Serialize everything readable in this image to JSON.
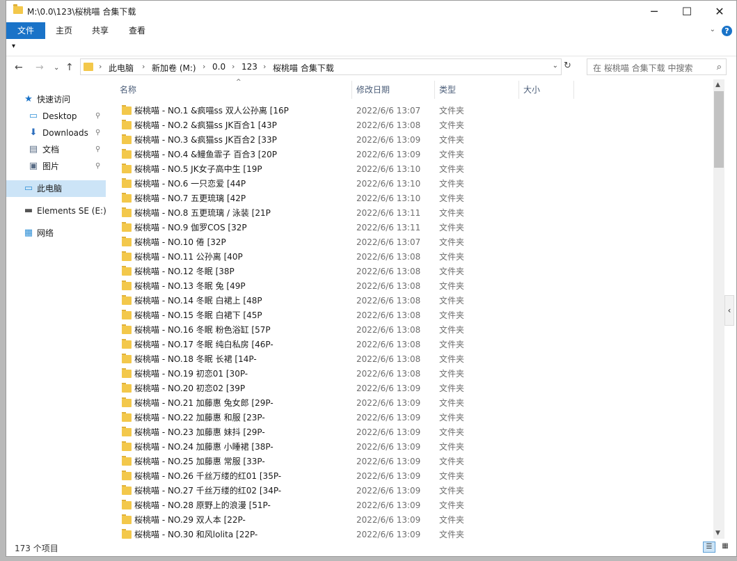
{
  "window": {
    "title": "M:\\0.0\\123\\桜桃喵 合集下载",
    "controls": [
      "─",
      "☐",
      "✕"
    ]
  },
  "ribbon": {
    "tabs": [
      "文件",
      "主页",
      "共享",
      "查看"
    ],
    "qat_label": "▾"
  },
  "address": {
    "crumbs": [
      "此电脑",
      "新加卷 (M:)",
      "0.0",
      "123",
      "桜桃喵 合集下载"
    ],
    "search_placeholder": "在 桜桃喵 合集下载 中搜索"
  },
  "navpane": {
    "items": [
      {
        "label": "快速访问",
        "icon": "star-icon",
        "pinned": false
      },
      {
        "label": "Desktop",
        "icon": "desktop-icon",
        "pinned": true
      },
      {
        "label": "Downloads",
        "icon": "download-icon",
        "pinned": true
      },
      {
        "label": "文档",
        "icon": "document-icon",
        "pinned": true
      },
      {
        "label": "图片",
        "icon": "picture-icon",
        "pinned": true
      },
      {
        "label": "此电脑",
        "icon": "computer-icon",
        "pinned": false,
        "selected": true
      },
      {
        "label": "Elements SE (E:)",
        "icon": "drive-icon",
        "pinned": false
      },
      {
        "label": "网络",
        "icon": "network-icon",
        "pinned": false
      }
    ]
  },
  "columns": [
    "名称",
    "修改日期",
    "类型",
    "大小"
  ],
  "files": [
    {
      "name": "桜桃喵 - NO.1 &疯喵ss 双人公孙离 [16P",
      "date": "2022/6/6 13:07",
      "type": "文件夹"
    },
    {
      "name": "桜桃喵 - NO.2 &疯猫ss JK百合1 [43P",
      "date": "2022/6/6 13:08",
      "type": "文件夹"
    },
    {
      "name": "桜桃喵 - NO.3 &疯猫ss JK百合2 [33P",
      "date": "2022/6/6 13:09",
      "type": "文件夹"
    },
    {
      "name": "桜桃喵 - NO.4 &鳗鱼霏子 百合3 [20P",
      "date": "2022/6/6 13:09",
      "type": "文件夹"
    },
    {
      "name": "桜桃喵 - NO.5 JK女子高中生 [19P",
      "date": "2022/6/6 13:10",
      "type": "文件夹"
    },
    {
      "name": "桜桃喵 - NO.6 一只恋爱 [44P",
      "date": "2022/6/6 13:10",
      "type": "文件夹"
    },
    {
      "name": "桜桃喵 - NO.7 五更琉璃 [42P",
      "date": "2022/6/6 13:10",
      "type": "文件夹"
    },
    {
      "name": "桜桃喵 - NO.8 五更琉璃 / 泳装 [21P",
      "date": "2022/6/6 13:11",
      "type": "文件夹"
    },
    {
      "name": "桜桃喵 - NO.9 伽罗COS [32P",
      "date": "2022/6/6 13:11",
      "type": "文件夹"
    },
    {
      "name": "桜桃喵 - NO.10 倦 [32P",
      "date": "2022/6/6 13:07",
      "type": "文件夹"
    },
    {
      "name": "桜桃喵 - NO.11 公孙离 [40P",
      "date": "2022/6/6 13:08",
      "type": "文件夹"
    },
    {
      "name": "桜桃喵 - NO.12 冬眠 [38P",
      "date": "2022/6/6 13:08",
      "type": "文件夹"
    },
    {
      "name": "桜桃喵 - NO.13 冬眠 兔 [49P",
      "date": "2022/6/6 13:08",
      "type": "文件夹"
    },
    {
      "name": "桜桃喵 - NO.14 冬眠 白裙上 [48P",
      "date": "2022/6/6 13:08",
      "type": "文件夹"
    },
    {
      "name": "桜桃喵 - NO.15 冬眠 白裙下 [45P",
      "date": "2022/6/6 13:08",
      "type": "文件夹"
    },
    {
      "name": "桜桃喵 - NO.16 冬眠 粉色浴缸 [57P",
      "date": "2022/6/6 13:08",
      "type": "文件夹"
    },
    {
      "name": "桜桃喵 - NO.17 冬眠 纯白私房 [46P-",
      "date": "2022/6/6 13:08",
      "type": "文件夹"
    },
    {
      "name": "桜桃喵 - NO.18 冬眠 长裙 [14P-",
      "date": "2022/6/6 13:08",
      "type": "文件夹"
    },
    {
      "name": "桜桃喵 - NO.19 初恋01 [30P-",
      "date": "2022/6/6 13:08",
      "type": "文件夹"
    },
    {
      "name": "桜桃喵 - NO.20 初恋02 [39P",
      "date": "2022/6/6 13:09",
      "type": "文件夹"
    },
    {
      "name": "桜桃喵 - NO.21 加藤惠 兔女郎 [29P-",
      "date": "2022/6/6 13:09",
      "type": "文件夹"
    },
    {
      "name": "桜桃喵 - NO.22 加藤惠 和服 [23P-",
      "date": "2022/6/6 13:09",
      "type": "文件夹"
    },
    {
      "name": "桜桃喵 - NO.23 加藤惠 妹抖 [29P-",
      "date": "2022/6/6 13:09",
      "type": "文件夹"
    },
    {
      "name": "桜桃喵 - NO.24 加藤惠 小睡裙 [38P-",
      "date": "2022/6/6 13:09",
      "type": "文件夹"
    },
    {
      "name": "桜桃喵 - NO.25 加藤惠 常服 [33P-",
      "date": "2022/6/6 13:09",
      "type": "文件夹"
    },
    {
      "name": "桜桃喵 - NO.26 千丝万缕的红01 [35P-",
      "date": "2022/6/6 13:09",
      "type": "文件夹"
    },
    {
      "name": "桜桃喵 - NO.27 千丝万缕的红02 [34P-",
      "date": "2022/6/6 13:09",
      "type": "文件夹"
    },
    {
      "name": "桜桃喵 - NO.28 原野上的浪漫 [51P-",
      "date": "2022/6/6 13:09",
      "type": "文件夹"
    },
    {
      "name": "桜桃喵 - NO.29 双人本 [22P-",
      "date": "2022/6/6 13:09",
      "type": "文件夹"
    },
    {
      "name": "桜桃喵 - NO.30 和风lolita [22P-",
      "date": "2022/6/6 13:09",
      "type": "文件夹"
    }
  ],
  "status": {
    "count": "173 个项目"
  },
  "colors": {
    "accent": "#1a73c8",
    "folder": "#f3c84b",
    "selection": "#cce4f7"
  }
}
